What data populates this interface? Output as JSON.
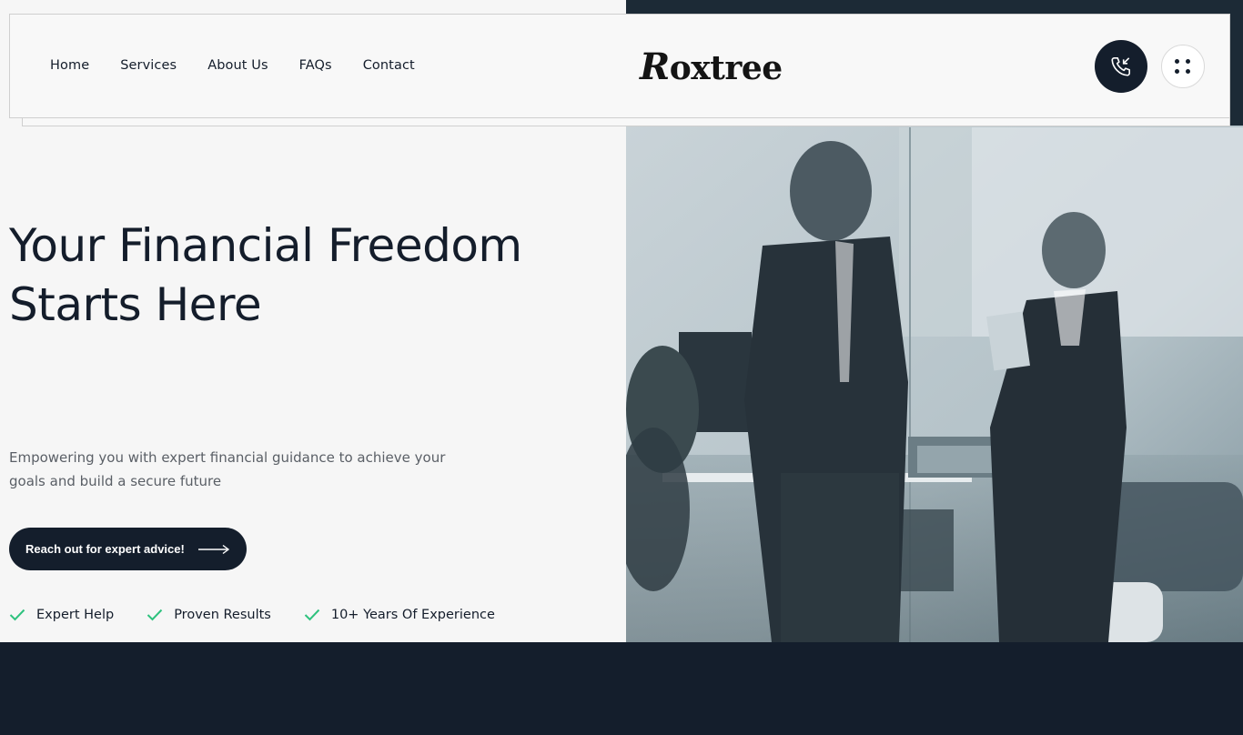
{
  "nav": {
    "items": [
      {
        "label": "Home"
      },
      {
        "label": "Services"
      },
      {
        "label": "About Us"
      },
      {
        "label": "FAQs"
      },
      {
        "label": "Contact"
      }
    ]
  },
  "brand": {
    "logo_initial": "R",
    "logo_rest": "oxtree"
  },
  "header_actions": {
    "call_icon": "phone-incoming-icon",
    "menu_icon": "grid-dots-icon"
  },
  "hero": {
    "title_line1": "Your Financial Freedom",
    "title_line2": "Starts Here",
    "subtitle_line1": "Empowering you with expert financial guidance to achieve your",
    "subtitle_line2": "goals and build a secure future",
    "cta_label": "Reach out for expert advice!",
    "features": [
      {
        "label": "Expert Help"
      },
      {
        "label": "Proven Results"
      },
      {
        "label": "10+ Years Of Experience"
      }
    ]
  },
  "colors": {
    "primary_dark": "#141e2c",
    "accent_check": "#2ec27e",
    "background": "#f6f6f6"
  }
}
